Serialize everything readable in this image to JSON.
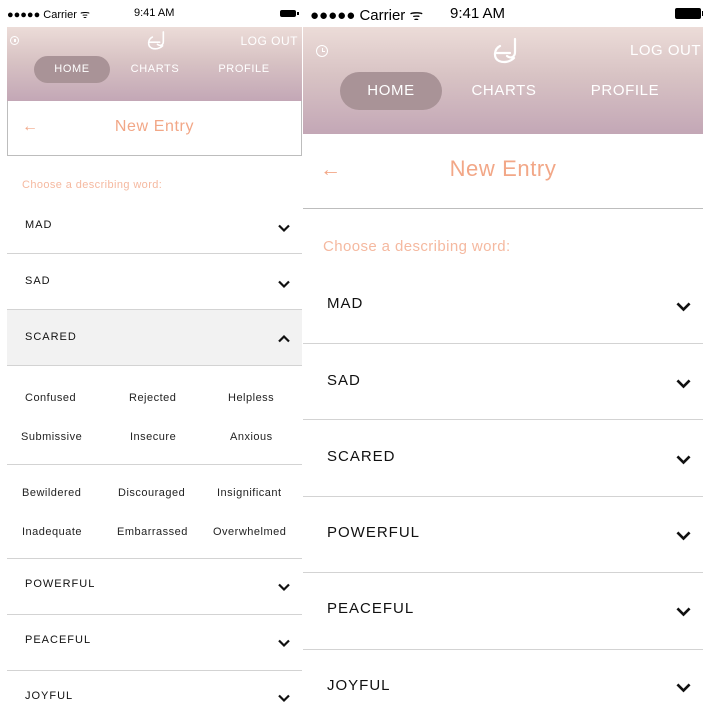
{
  "status_bar": {
    "carrier": "●●●●● Carrier ᯤ",
    "time": "9:41 AM"
  },
  "header": {
    "logout_label": "LOG OUT",
    "tabs": {
      "home": "HOME",
      "charts": "CHARTS",
      "profile": "PROFILE"
    },
    "active_tab": "home"
  },
  "entry": {
    "back_arrow": "←",
    "title": "New Entry",
    "prompt": "Choose a describing word:"
  },
  "categories": {
    "mad": "MAD",
    "sad": "SAD",
    "scared": "SCARED",
    "powerful": "POWERFUL",
    "peaceful": "PEACEFUL",
    "joyful": "JOYFUL"
  },
  "scared_words": {
    "confused": "Confused",
    "rejected": "Rejected",
    "helpless": "Helpless",
    "submissive": "Submissive",
    "insecure": "Insecure",
    "anxious": "Anxious",
    "bewildered": "Bewildered",
    "discouraged": "Discouraged",
    "insignificant": "Insignificant",
    "inadequate": "Inadequate",
    "embarrassed": "Embarrassed",
    "overwhelmed": "Overwhelmed"
  },
  "colors": {
    "accent": "#f2a787",
    "header_top": "#ecdcd8",
    "header_bottom": "#c3a7b6",
    "active_tab": "#a99397"
  },
  "icons": {
    "history": "history-icon",
    "logo": "logo-icon",
    "back": "back-arrow-icon",
    "collapsed": "chevron-down-icon",
    "expanded": "chevron-up-icon"
  }
}
